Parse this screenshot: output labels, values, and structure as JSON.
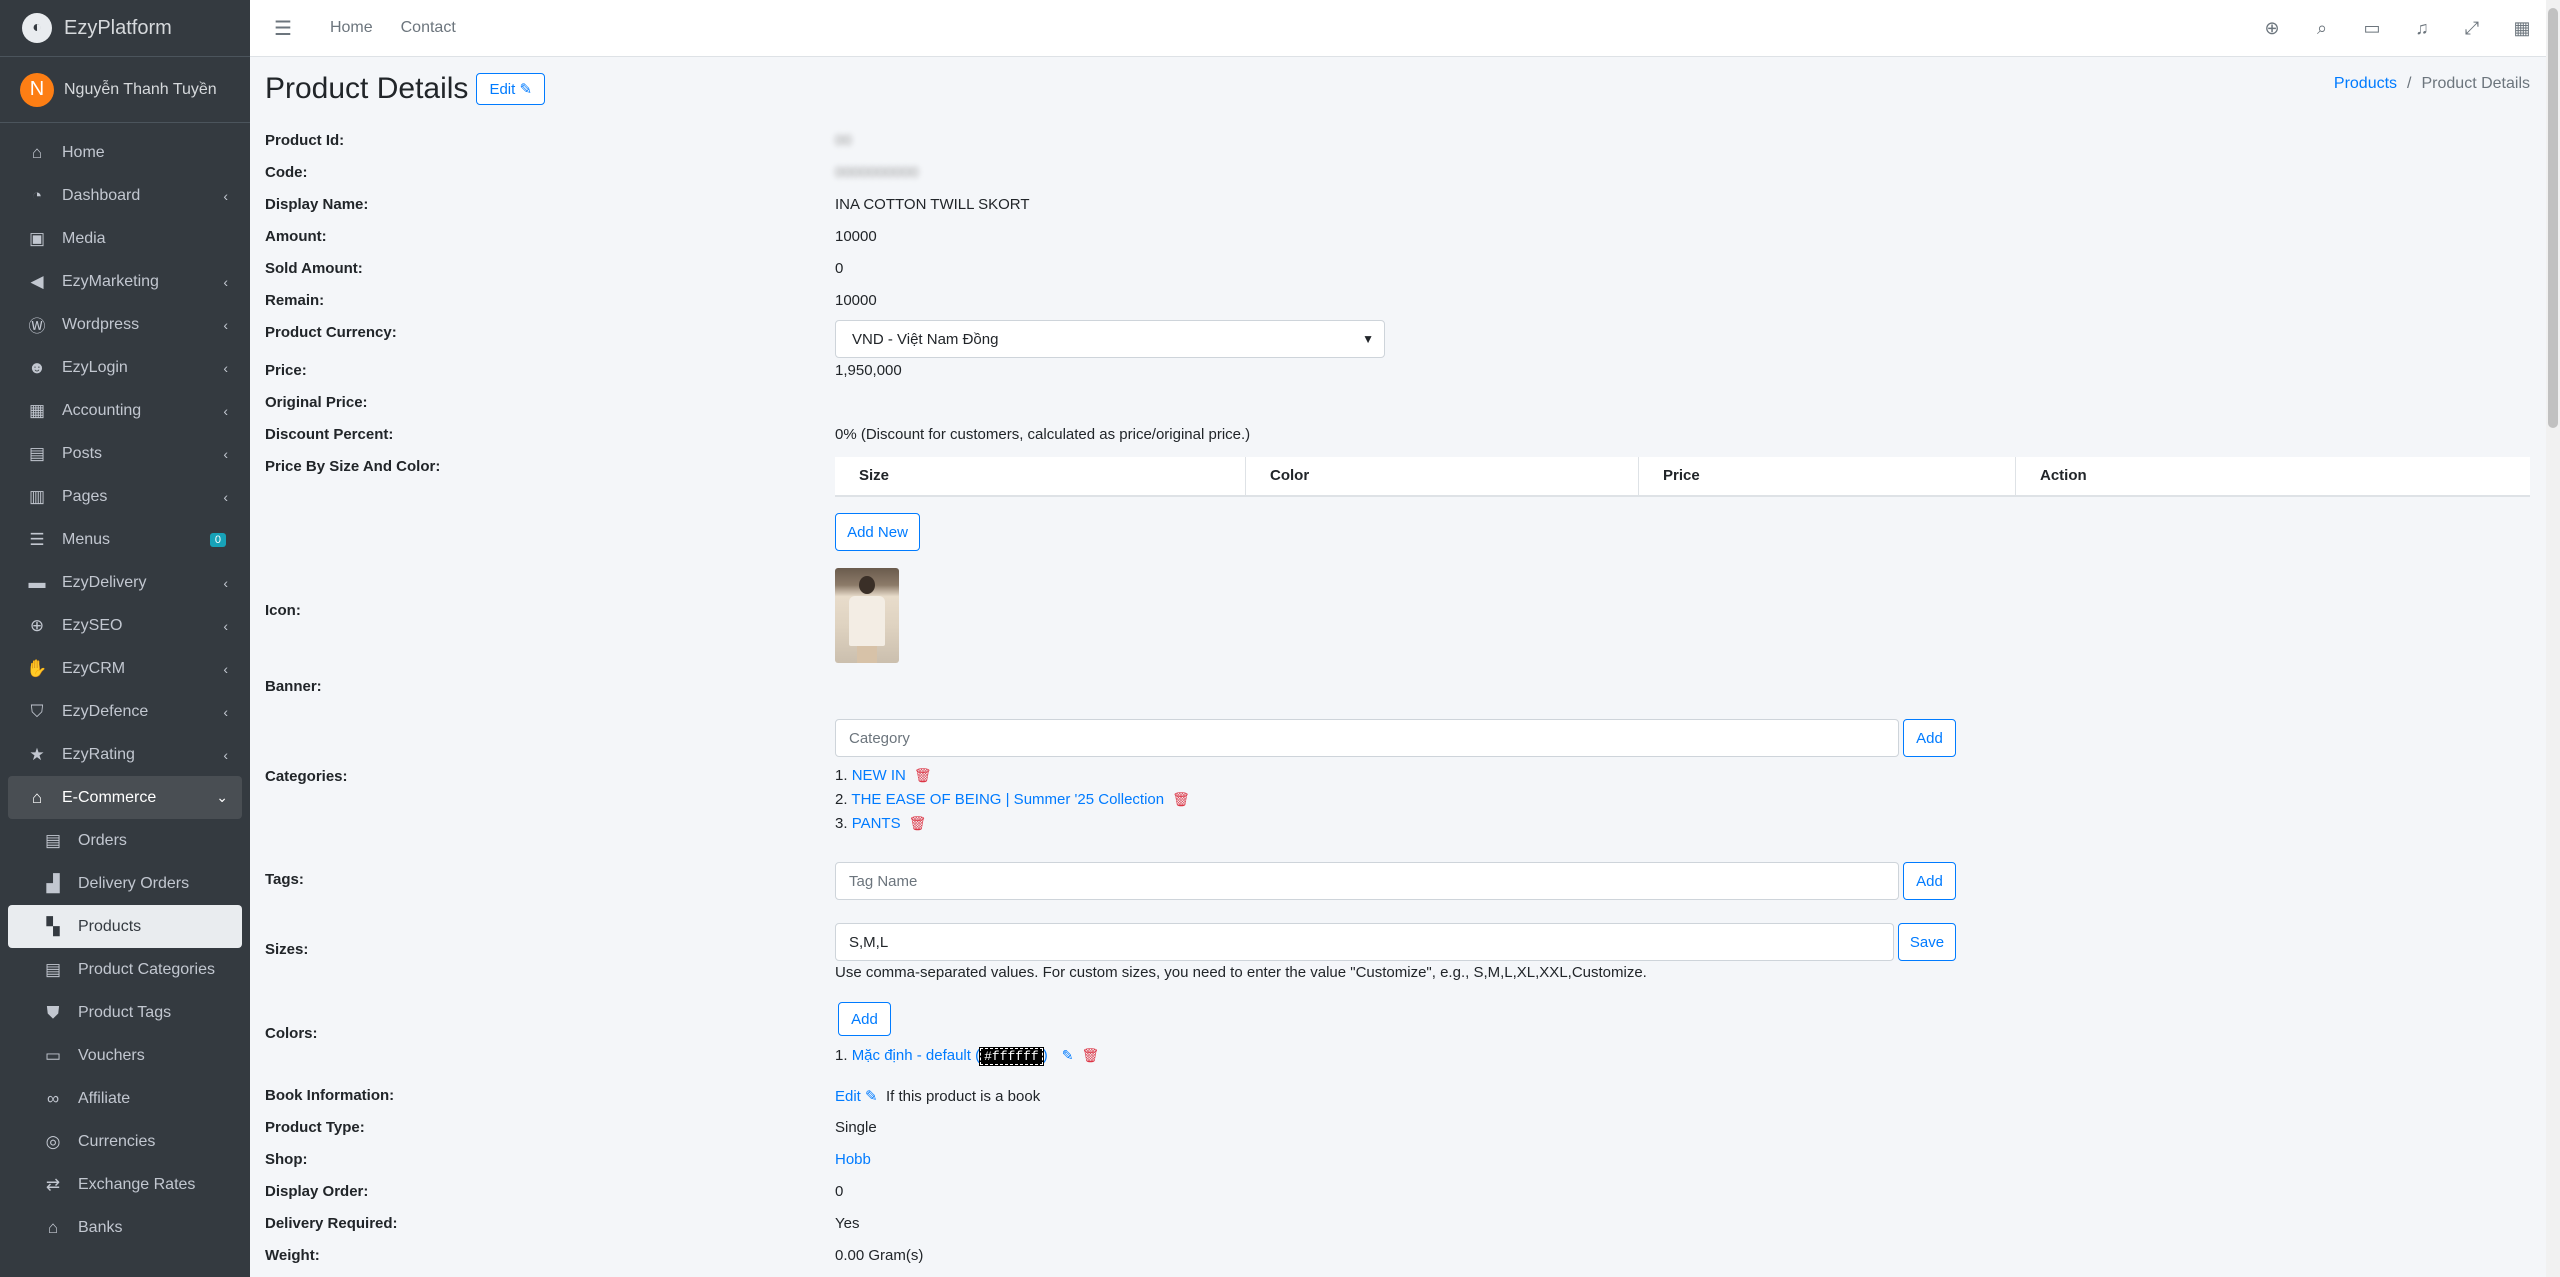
{
  "app": {
    "brand": "EzyPlatform",
    "user_initial": "N",
    "user_name": "Nguyễn Thanh Tuyền"
  },
  "sidebar": {
    "items": [
      {
        "label": "Home"
      },
      {
        "label": "Dashboard"
      },
      {
        "label": "Media"
      },
      {
        "label": "EzyMarketing"
      },
      {
        "label": "Wordpress"
      },
      {
        "label": "EzyLogin"
      },
      {
        "label": "Accounting"
      },
      {
        "label": "Posts"
      },
      {
        "label": "Pages"
      },
      {
        "label": "Menus",
        "badge": "0"
      },
      {
        "label": "EzyDelivery"
      },
      {
        "label": "EzySEO"
      },
      {
        "label": "EzyCRM"
      },
      {
        "label": "EzyDefence"
      },
      {
        "label": "EzyRating"
      },
      {
        "label": "E-Commerce"
      }
    ],
    "sub_items": [
      {
        "label": "Orders"
      },
      {
        "label": "Delivery Orders"
      },
      {
        "label": "Products"
      },
      {
        "label": "Product Categories"
      },
      {
        "label": "Product Tags"
      },
      {
        "label": "Vouchers"
      },
      {
        "label": "Affiliate"
      },
      {
        "label": "Currencies"
      },
      {
        "label": "Exchange Rates"
      },
      {
        "label": "Banks"
      }
    ]
  },
  "topbar": {
    "home": "Home",
    "contact": "Contact"
  },
  "page": {
    "title": "Product Details",
    "edit_label": "Edit",
    "breadcrumb": {
      "parent": "Products",
      "current": "Product Details"
    }
  },
  "fields": {
    "product_id": {
      "label": "Product Id:",
      "value": "00"
    },
    "code": {
      "label": "Code:",
      "value": "0000000000"
    },
    "display_name": {
      "label": "Display Name:",
      "value": "INA COTTON TWILL SKORT"
    },
    "amount": {
      "label": "Amount:",
      "value": "10000"
    },
    "sold_amount": {
      "label": "Sold Amount:",
      "value": "0"
    },
    "remain": {
      "label": "Remain:",
      "value": "10000"
    },
    "currency": {
      "label": "Product Currency:",
      "value": "VND - Việt Nam Đồng"
    },
    "price": {
      "label": "Price:",
      "value": "1,950,000"
    },
    "original_price": {
      "label": "Original Price:",
      "value": ""
    },
    "discount": {
      "label": "Discount Percent:",
      "value": "0% (Discount for customers, calculated as price/original price.)"
    },
    "price_by_size": {
      "label": "Price By Size And Color:",
      "columns": [
        "Size",
        "Color",
        "Price",
        "Action"
      ],
      "add_label": "Add New"
    },
    "icon": {
      "label": "Icon:"
    },
    "banner": {
      "label": "Banner:"
    },
    "categories": {
      "label": "Categories:",
      "placeholder": "Category",
      "add_label": "Add",
      "items": [
        {
          "num": "1.",
          "name": "NEW IN"
        },
        {
          "num": "2.",
          "name": "THE EASE OF BEING | Summer '25 Collection"
        },
        {
          "num": "3.",
          "name": "PANTS"
        }
      ]
    },
    "tags": {
      "label": "Tags:",
      "placeholder": "Tag Name",
      "add_label": "Add"
    },
    "sizes": {
      "label": "Sizes:",
      "value": "S,M,L",
      "save_label": "Save",
      "hint": "Use comma-separated values. For custom sizes, you need to enter the value \"Customize\", e.g., S,M,L,XL,XXL,Customize."
    },
    "colors": {
      "label": "Colors:",
      "add_label": "Add",
      "items": [
        {
          "num": "1.",
          "name": "Mặc định - default",
          "code": "#ffffff"
        }
      ]
    },
    "book_info": {
      "label": "Book Information:",
      "edit_label": "Edit",
      "hint": "If this product is a book"
    },
    "product_type": {
      "label": "Product Type:",
      "value": "Single"
    },
    "shop": {
      "label": "Shop:",
      "value": "Hobb"
    },
    "display_order": {
      "label": "Display Order:",
      "value": "0"
    },
    "delivery_required": {
      "label": "Delivery Required:",
      "value": "Yes"
    },
    "weight": {
      "label": "Weight:",
      "value": "0.00 Gram(s)"
    }
  }
}
